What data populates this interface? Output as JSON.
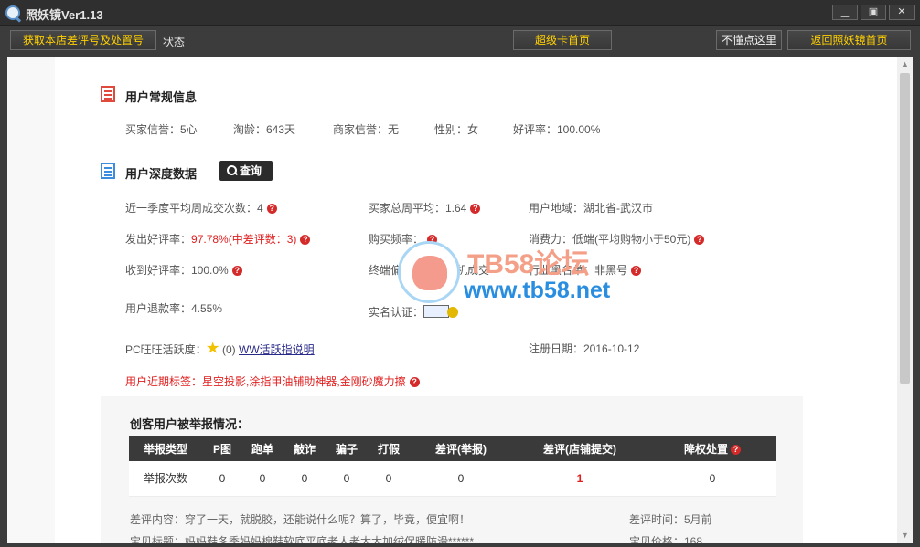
{
  "window": {
    "title": "照妖镜Ver1.13",
    "min": "▁",
    "max": "▣",
    "close": "✕"
  },
  "toolbar": {
    "get_label": "获取本店差评号及处置号",
    "status_label": "状态",
    "super_label": "超级卡首页",
    "help_label": "不懂点这里",
    "home_label": "返回照妖镜首页"
  },
  "basic": {
    "title": "用户常规信息",
    "buyer_credit": "买家信誉：5心",
    "taobao_age": "淘龄：643天",
    "seller_credit": "商家信誉：无",
    "gender": "性别：女",
    "good_rate": "好评率：100.00%"
  },
  "deep": {
    "title": "用户深度数据",
    "query_label": "查询",
    "q_avg_label": "近一季度平均周成交次数：4",
    "buyer_weekly_label": "买家总周平均：1.64",
    "region_label": "用户地域：湖北省-武汉市",
    "sent_good_label": "发出好评率：",
    "sent_good_value": "97.78%(中差评数：3)",
    "buy_freq_label": "购买频率：",
    "consume_label": "消费力：低端(平均购物小于50元)",
    "recv_good_label": "收到好评率：100.0%",
    "device_label": "终端偏好：98%手机成交",
    "blacklist_label": "行业黑名单：非黑号",
    "refund_label": "用户退款率：4.55%",
    "realname_label": "实名认证：",
    "pc_active_label": "PC旺旺活跃度：",
    "pc_active_value": "(0)",
    "ww_link": "WW活跃指说明",
    "reg_date_label": "注册日期：2016-10-12",
    "tags": "用户近期标签：星空投影,涂指甲油辅助神器,金刚砂魔力擦",
    "qmark": "?"
  },
  "report": {
    "title": "创客用户被举报情况：",
    "headers": [
      "举报类型",
      "P图",
      "跑单",
      "敲诈",
      "骗子",
      "打假",
      "差评(举报)",
      "差评(店铺提交)",
      "降权处置"
    ],
    "row_label": "举报次数",
    "values": [
      "0",
      "0",
      "0",
      "0",
      "0",
      "0",
      "1",
      "0"
    ],
    "comment": "差评内容：穿了一天，就脱胶，还能说什么呢？算了，毕竟，便宜啊！",
    "comment_time": "差评时间：5月前",
    "product": "宝贝标题：妈妈鞋冬季妈妈棉鞋软底平底老人老太太加绒保暖防滑******",
    "price": "宝贝价格：168"
  },
  "watermark": {
    "title": "TB58论坛",
    "url": "www.tb58.net"
  },
  "colors": {
    "accent_yellow": "#ffd000",
    "warn_red": "#e02020",
    "dark": "#3c3c3c",
    "icon_blue": "#3c8de0",
    "icon_red": "#e04a3c"
  }
}
